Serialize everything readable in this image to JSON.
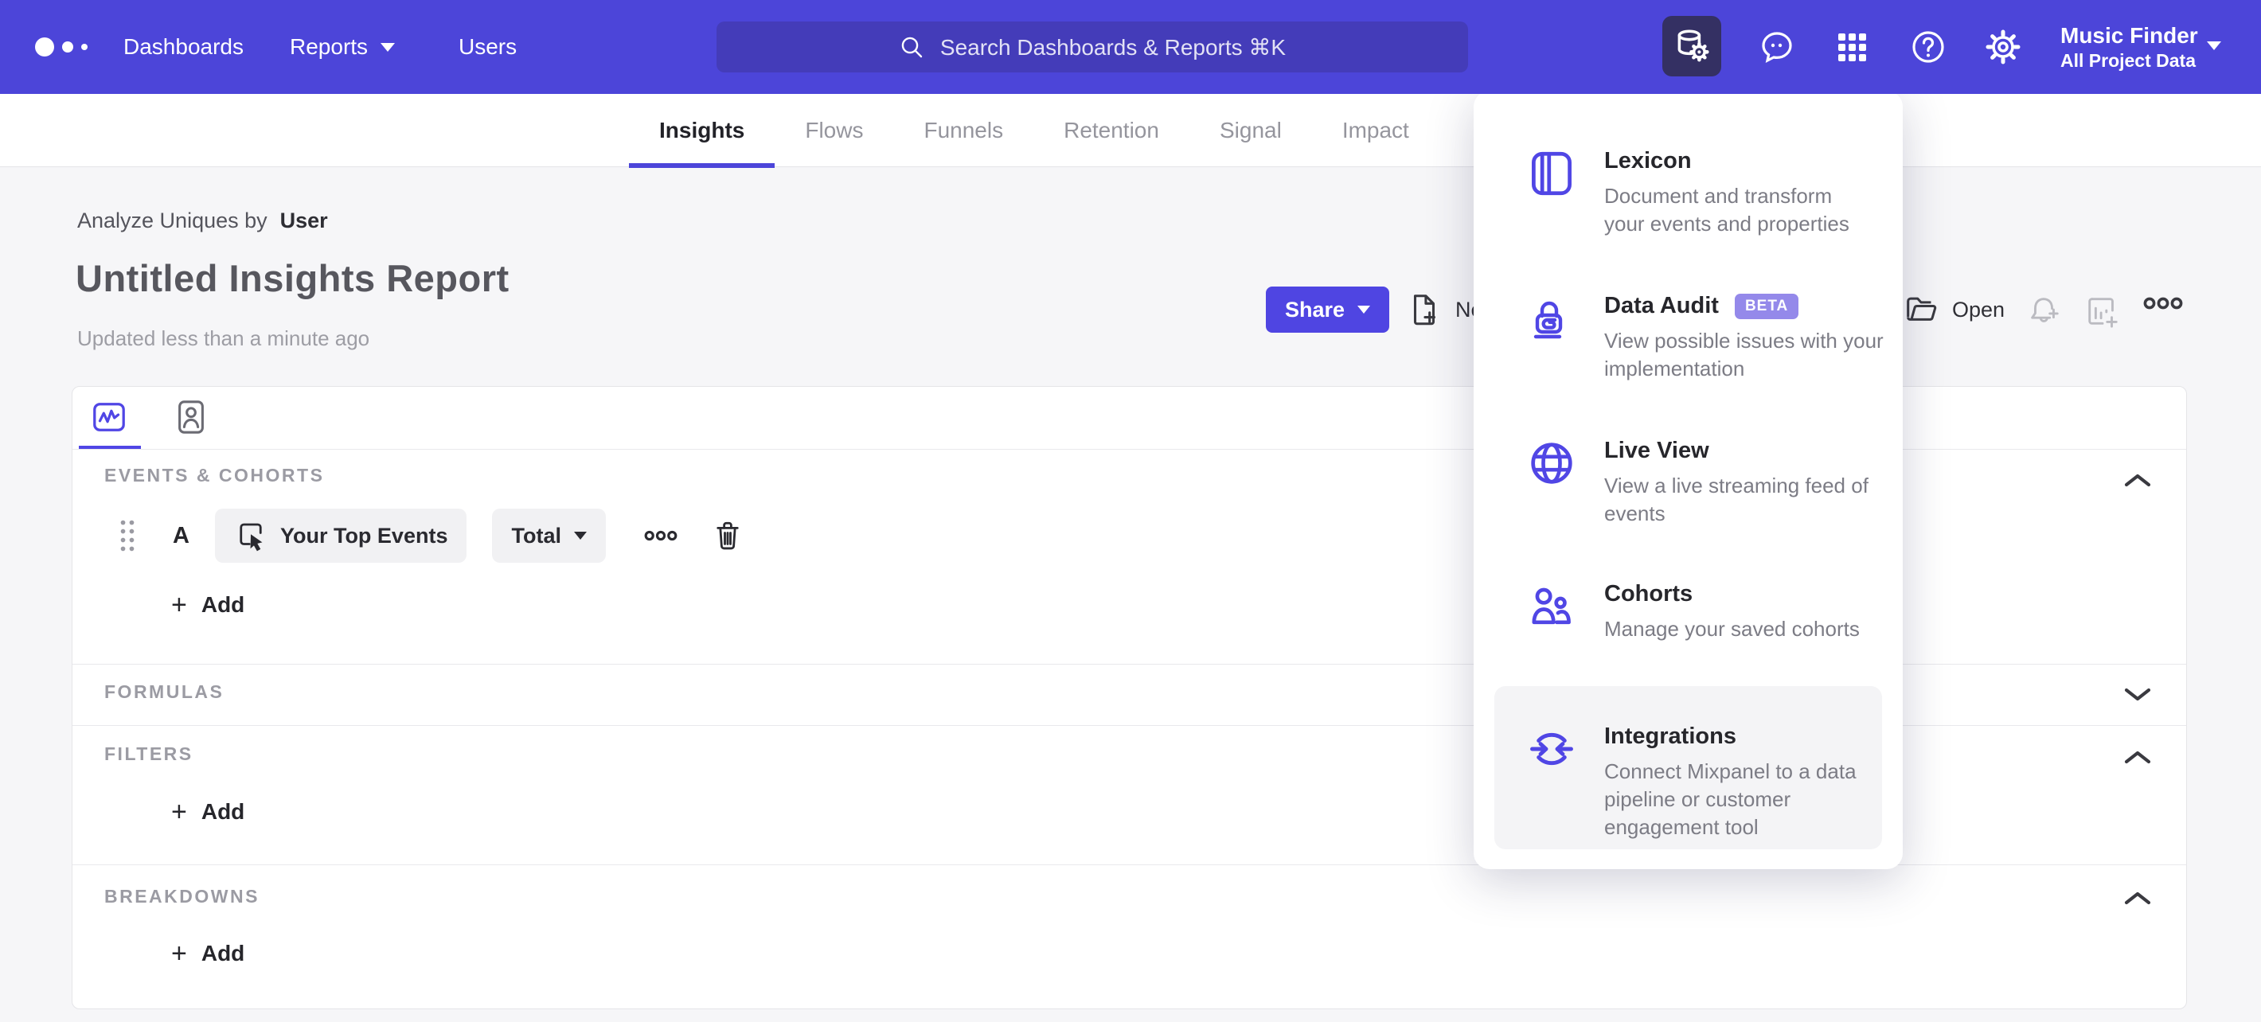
{
  "header": {
    "nav": [
      {
        "label": "Dashboards"
      },
      {
        "label": "Reports"
      },
      {
        "label": "Users"
      }
    ],
    "search_placeholder": "Search Dashboards & Reports ⌘K",
    "project": {
      "name": "Music Finder",
      "scope": "All Project Data"
    }
  },
  "tabs": {
    "items": [
      "Insights",
      "Flows",
      "Funnels",
      "Retention",
      "Signal",
      "Impact"
    ],
    "active": "Insights"
  },
  "report": {
    "analyze_label": "Analyze Uniques by",
    "analyze_value": "User",
    "title": "Untitled Insights Report",
    "updated": "Updated less than a minute ago",
    "share_label": "Share",
    "new_label": "New",
    "open_label": "Open"
  },
  "builder": {
    "sections": {
      "events": "EVENTS & COHORTS",
      "formulas": "FORMULAS",
      "filters": "FILTERS",
      "breakdowns": "BREAKDOWNS"
    },
    "event_row": {
      "letter": "A",
      "event": "Your Top Events",
      "metric": "Total"
    },
    "add_label": "Add"
  },
  "menu": {
    "items": [
      {
        "title": "Lexicon",
        "desc": "Document and transform your events and properties"
      },
      {
        "title": "Data Audit",
        "badge": "BETA",
        "desc": "View possible issues with your implementation"
      },
      {
        "title": "Live View",
        "desc": "View a live streaming feed of events"
      },
      {
        "title": "Cohorts",
        "desc": "Manage your saved cohorts"
      },
      {
        "title": "Integrations",
        "desc": "Connect Mixpanel to a data pipeline or customer engagement tool"
      }
    ]
  },
  "colors": {
    "topbar": "#4C45D9",
    "accent": "#5046E5",
    "share_button": "#4F45E2",
    "beta_badge": "#9489EA",
    "page_bg": "#F6F6F8"
  }
}
